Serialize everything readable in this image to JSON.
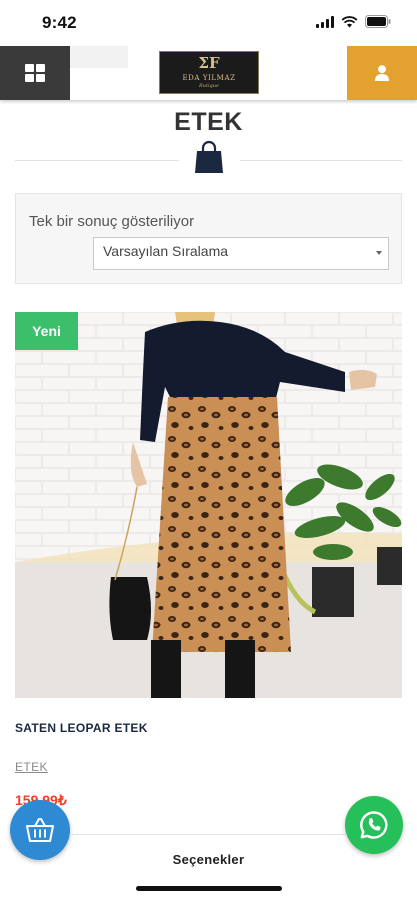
{
  "status_bar": {
    "time": "9:42"
  },
  "header": {
    "logo_mark": "ƩF",
    "logo_text": "EDA YILMAZ",
    "logo_sub": "Butique",
    "menu_icon": "grid-icon",
    "user_icon": "user-icon"
  },
  "page": {
    "title": "ETEK",
    "title_icon": "shopping-bag-icon"
  },
  "filter": {
    "result_count": "Tek bir sonuç gösteriliyor",
    "sort_selected": "Varsayılan Sıralama"
  },
  "product": {
    "badge": "Yeni",
    "name": "SATEN LEOPAR ETEK",
    "category": "ETEK",
    "price": "159,99₺",
    "options_label": "Seçenekler"
  },
  "colors": {
    "menu_bg": "#3a3a3a",
    "user_bg": "#e3a12f",
    "badge_green": "#3bbf6a",
    "price_red": "#f4402a",
    "cart_blue": "#2f8ad4",
    "whatsapp_green": "#25c05a"
  },
  "fabs": {
    "cart_icon": "basket-icon",
    "whatsapp_icon": "whatsapp-icon"
  }
}
